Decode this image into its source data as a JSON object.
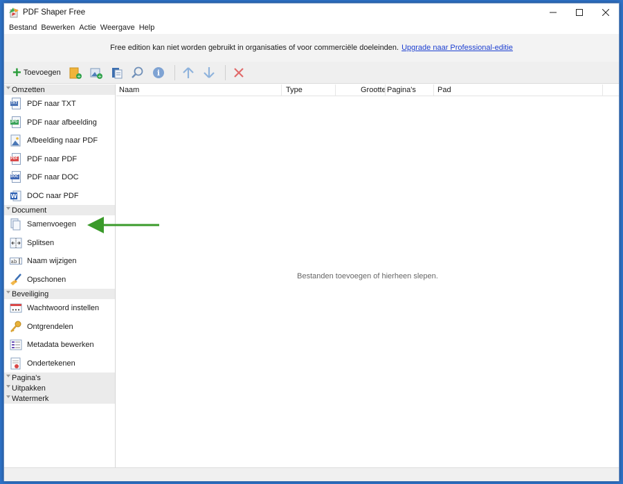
{
  "window": {
    "title": "PDF Shaper Free",
    "minimize": "—",
    "maximize": "☐",
    "close": "✕"
  },
  "menu": [
    "Bestand",
    "Bewerken",
    "Actie",
    "Weergave",
    "Help"
  ],
  "notice": {
    "text": "Free edition kan niet worden gebruikt in organisaties of voor commerciële doeleinden.",
    "link": "Upgrade naar Professional-editie"
  },
  "toolbar": {
    "add_label": "Toevoegen"
  },
  "sidebar": {
    "groups": [
      {
        "header": "Omzetten",
        "items": [
          {
            "label": "PDF naar TXT",
            "icon": "txt-file-icon"
          },
          {
            "label": "PDF naar afbeelding",
            "icon": "jpg-file-icon"
          },
          {
            "label": "Afbeelding naar PDF",
            "icon": "image-file-icon"
          },
          {
            "label": "PDF naar PDF",
            "icon": "pdf-file-icon"
          },
          {
            "label": "PDF naar DOC",
            "icon": "doc-file-icon"
          },
          {
            "label": "DOC naar PDF",
            "icon": "word-icon"
          }
        ]
      },
      {
        "header": "Document",
        "items": [
          {
            "label": "Samenvoegen",
            "icon": "merge-icon"
          },
          {
            "label": "Splitsen",
            "icon": "split-icon"
          },
          {
            "label": "Naam wijzigen",
            "icon": "rename-icon"
          },
          {
            "label": "Opschonen",
            "icon": "broom-icon"
          }
        ]
      },
      {
        "header": "Beveiliging",
        "items": [
          {
            "label": "Wachtwoord instellen",
            "icon": "password-icon"
          },
          {
            "label": "Ontgrendelen",
            "icon": "key-icon"
          },
          {
            "label": "Metadata bewerken",
            "icon": "metadata-icon"
          },
          {
            "label": "Ondertekenen",
            "icon": "signature-icon"
          }
        ]
      },
      {
        "header": "Pagina's",
        "items": []
      },
      {
        "header": "Uitpakken",
        "items": []
      },
      {
        "header": "Watermerk",
        "items": []
      }
    ]
  },
  "list": {
    "columns": [
      "Naam",
      "Type",
      "Grootte",
      "Pagina's",
      "Pad"
    ],
    "empty_message": "Bestanden toevoegen of hierheen slepen."
  },
  "colors": {
    "accent": "#2a9d3a",
    "link": "#1c3fd0",
    "arrow": "#3a9a2a"
  }
}
